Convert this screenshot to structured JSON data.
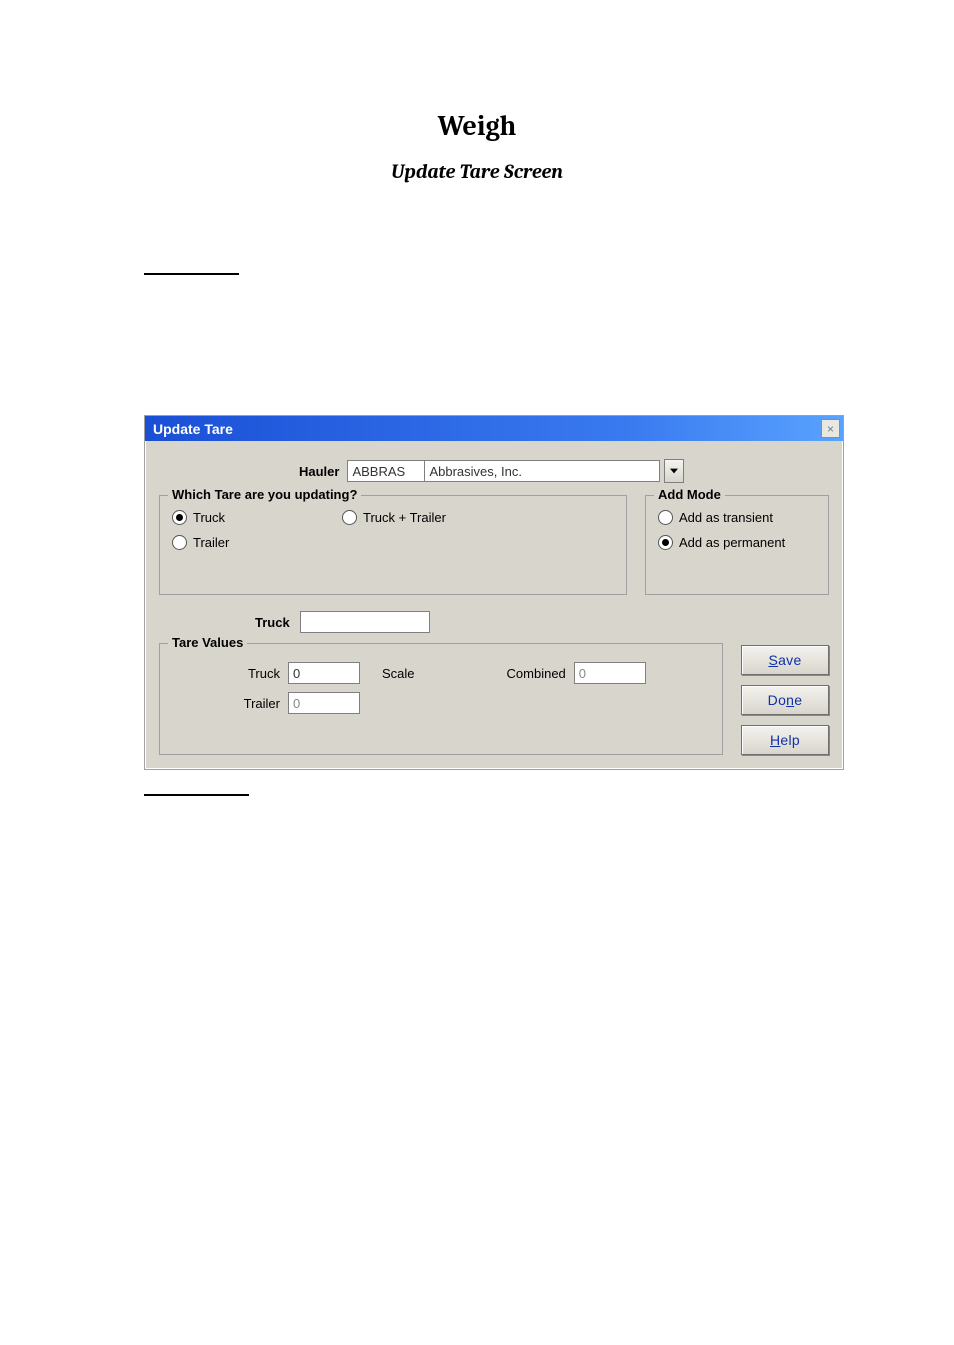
{
  "doc": {
    "title": "Weigh",
    "subtitle": "Update Tare Screen"
  },
  "dialog": {
    "title": "Update Tare",
    "hauler": {
      "label": "Hauler",
      "code": "ABBRAS",
      "name": "Abbrasives, Inc."
    },
    "which_group": {
      "legend": "Which Tare are you updating?",
      "truck": "Truck",
      "trailer": "Trailer",
      "truck_trailer": "Truck + Trailer"
    },
    "addmode_group": {
      "legend": "Add Mode",
      "transient": "Add as transient",
      "permanent": "Add as permanent"
    },
    "truck_row": {
      "label": "Truck",
      "value": ""
    },
    "tare_values": {
      "legend": "Tare Values",
      "truck_label": "Truck",
      "truck_value": "0",
      "scale_label": "Scale",
      "combined_label": "Combined",
      "combined_value": "0",
      "trailer_label": "Trailer",
      "trailer_value": "0"
    },
    "buttons": {
      "save_full": "Save",
      "save_ul": "S",
      "save_rest": "ave",
      "done_full": "Done",
      "done_pre": "Do",
      "done_ul": "n",
      "done_post": "e",
      "help_full": "Help",
      "help_ul": "H",
      "help_rest": "elp"
    }
  }
}
